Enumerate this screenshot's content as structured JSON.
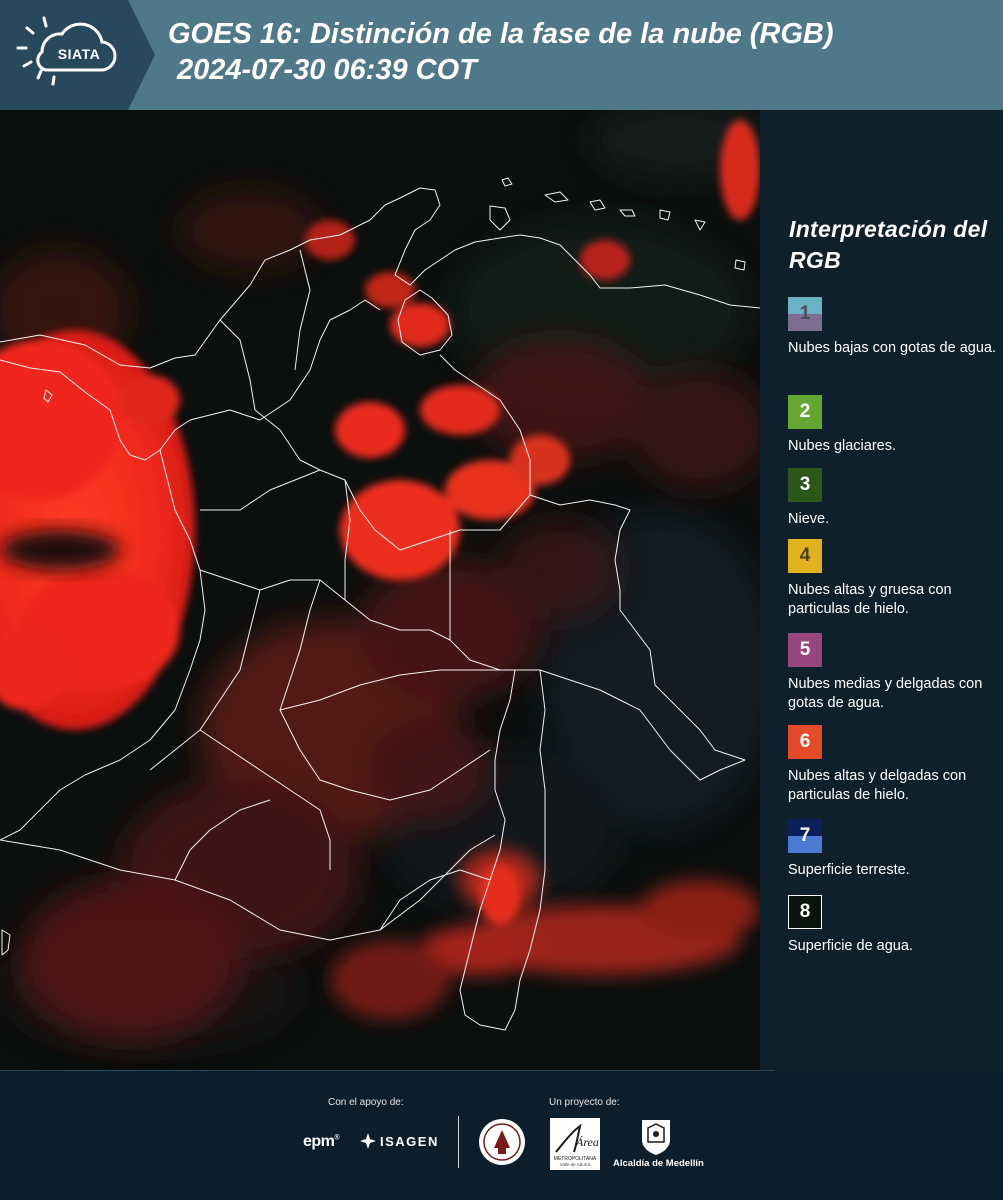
{
  "header": {
    "logo_text": "SIATA",
    "title_line1": "GOES 16: Distinción de la fase de la nube (RGB)",
    "title_line2": "2024-07-30 06:39 COT",
    "colors": {
      "bar": "#4f7888",
      "logo_bg": "#28495b"
    }
  },
  "map": {
    "icon": "satellite-rgb-image",
    "dominant_color": "#e8281c"
  },
  "legend": {
    "title": "Interpretación del RGB",
    "items": [
      {
        "number": "1",
        "label": "Nubes bajas con gotas de agua.",
        "colors": [
          "#69b3c5",
          "#7d6e8f"
        ],
        "text_color": "#4e4a5e"
      },
      {
        "number": "2",
        "label": "Nubes glaciares.",
        "colors": [
          "#63a631"
        ],
        "text_color": "#ffffff"
      },
      {
        "number": "3",
        "label": "Nieve.",
        "colors": [
          "#2c5718"
        ],
        "text_color": "#ffffff"
      },
      {
        "number": "4",
        "label": "Nubes altas y gruesa con particulas de hielo.",
        "colors": [
          "#e1b21c"
        ],
        "text_color": "#4a3d10"
      },
      {
        "number": "5",
        "label": "Nubes medias y delgadas con gotas de agua.",
        "colors": [
          "#99467f"
        ],
        "text_color": "#ffffff"
      },
      {
        "number": "6",
        "label": "Nubes altas y delgadas con particulas de hielo.",
        "colors": [
          "#e44b2b"
        ],
        "text_color": "#ffffff"
      },
      {
        "number": "7",
        "label": "Superficie terreste.",
        "colors": [
          "#0d1f5a",
          "#4a7ad1"
        ],
        "text_color": "#ffffff"
      },
      {
        "number": "8",
        "label": "Superficie de agua.",
        "colors": [
          "#08140c"
        ],
        "text_color": "#ffffff"
      }
    ]
  },
  "footer": {
    "support_label": "Con el apoyo de:",
    "project_label": "Un proyecto de:",
    "epm": "epm",
    "isagen": "ISAGEN",
    "area_logo_text": [
      "Área",
      "METROPOLITANA",
      "Valle de Aburrá"
    ],
    "alcaldia": "Alcaldía de Medellín"
  }
}
